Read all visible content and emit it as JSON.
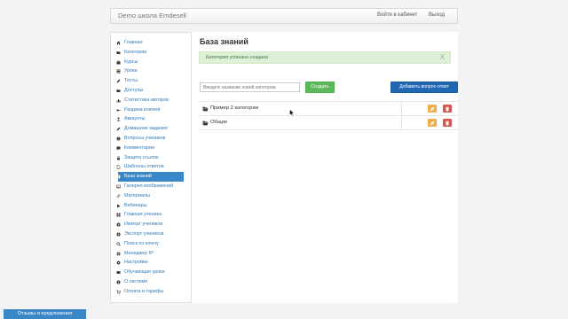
{
  "header": {
    "brand": "Demo школа Emdesell",
    "login_label": "Войти в кабинет",
    "logout_label": "Выход"
  },
  "sidebar": {
    "items": [
      {
        "label": "Главная",
        "icon": "home-icon"
      },
      {
        "label": "Категории",
        "icon": "folder-icon"
      },
      {
        "label": "Курсы",
        "icon": "briefcase-icon"
      },
      {
        "label": "Уроки",
        "icon": "list-icon"
      },
      {
        "label": "Тесты",
        "icon": "pencil-icon"
      },
      {
        "label": "Доступы",
        "icon": "folder-icon"
      },
      {
        "label": "Статистика авторов",
        "icon": "stats-icon"
      },
      {
        "label": "Раздача ключей",
        "icon": "key-icon"
      },
      {
        "label": "Аккаунты",
        "icon": "user-icon"
      },
      {
        "label": "Домашние задания",
        "icon": "pencil-icon"
      },
      {
        "label": "Вопросы учеников",
        "icon": "question-icon"
      },
      {
        "label": "Комментарии",
        "icon": "comment-icon"
      },
      {
        "label": "Защита ссылок",
        "icon": "lock-icon"
      },
      {
        "label": "Шаблоны ответов",
        "icon": "file-icon"
      },
      {
        "label": "База знаний",
        "icon": "info-icon",
        "active": true
      },
      {
        "label": "Галерея изображений",
        "icon": "picture-icon"
      },
      {
        "label": "Материалы",
        "icon": "paperclip-icon"
      },
      {
        "label": "Вебинары",
        "icon": "play-icon"
      },
      {
        "label": "Главная ученика",
        "icon": "grid-icon"
      },
      {
        "label": "Импорт учеников",
        "icon": "download-icon"
      },
      {
        "label": "Экспорт учеников",
        "icon": "upload-icon"
      },
      {
        "label": "Поиск по ключу",
        "icon": "search-icon"
      },
      {
        "label": "Менеджер IP",
        "icon": "globe-icon"
      },
      {
        "label": "Настройки",
        "icon": "gear-icon"
      },
      {
        "label": "Обучающие уроки",
        "icon": "film-icon"
      },
      {
        "label": "О системе",
        "icon": "info-icon"
      },
      {
        "label": "Оплата и тарифы",
        "icon": "cart-icon"
      }
    ]
  },
  "main": {
    "title": "База знаний",
    "alert": {
      "message": "Категория успешно создана",
      "close": "X"
    },
    "category_input": {
      "placeholder": "Введите название новой категории",
      "value": ""
    },
    "create_label": "Создать",
    "add_qa_label": "Добавить вопрос-ответ",
    "categories": [
      {
        "name": "Пример 2 категории"
      },
      {
        "name": "Общие"
      }
    ]
  },
  "footer": {
    "feedback_label": "Отзывы и предложения"
  },
  "colors": {
    "accent": "#3a87c8",
    "success": "#5cb85c",
    "warning": "#f0ad4e",
    "danger": "#d9534f",
    "primary_dark": "#2067b4"
  }
}
